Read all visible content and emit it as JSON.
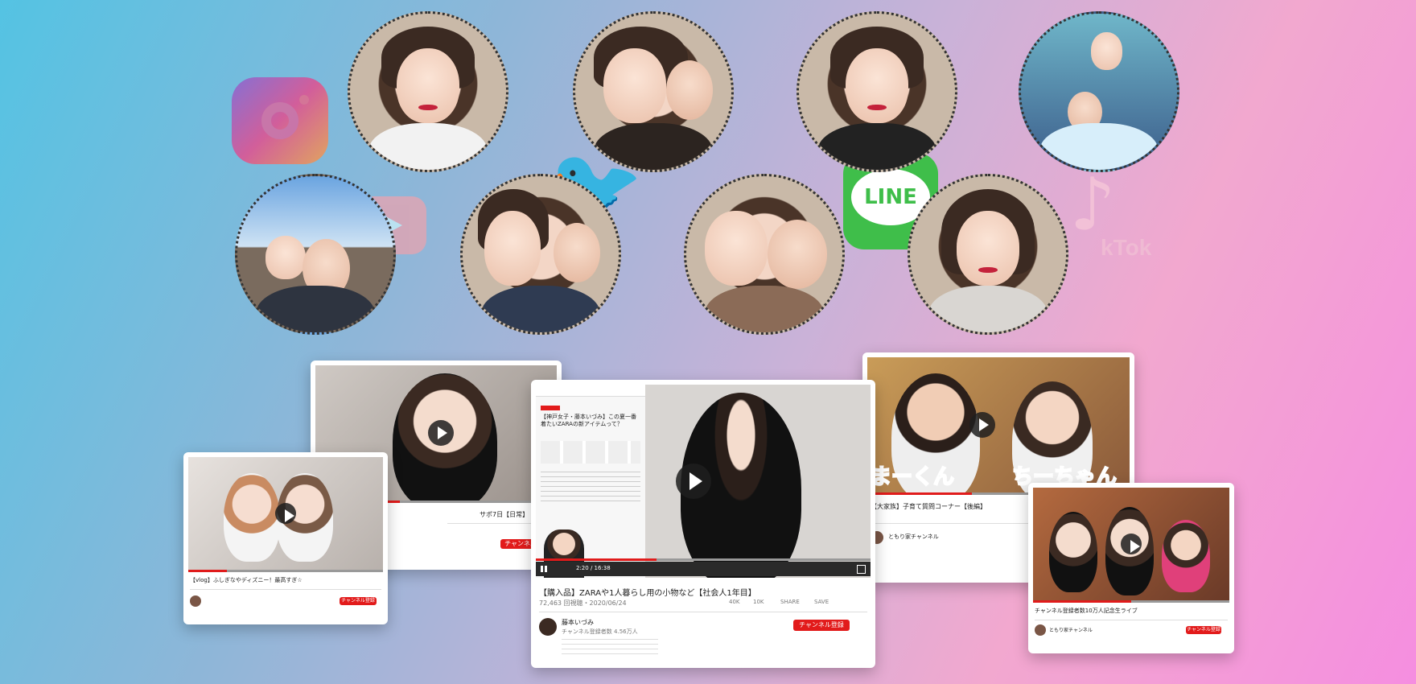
{
  "icons": {
    "instagram": "instagram-icon",
    "youtube": "youtube-icon",
    "twitter": "twitter-icon",
    "line": "line-icon",
    "line_label": "LINE",
    "tiktok": "tiktok-icon",
    "tiktok_label": "kTok"
  },
  "colors": {
    "accent_red": "#e21b1b",
    "line_green": "#3fbe4a",
    "twitter_blue": "#4aa3e8",
    "caption_green": "#2fb53a",
    "caption_pink": "#ef3f8a"
  },
  "main_card": {
    "title": "【購入品】ZARAや1人暮らし用の小物など【社会人1年目】",
    "meta": "72,463 回視聴・2020/06/24",
    "likes": "40K",
    "dislikes": "10K",
    "share": "SHARE",
    "save": "SAVE",
    "channel": "藤本いづみ",
    "subscribers": "チャンネル登録者数 4.56万人",
    "subscribe_label": "チャンネル登録",
    "time": "2:20 / 16:38",
    "article_heading": "【神戸女子・藤本いづみ】この夏一番着たいZARAの新アイテムって？"
  },
  "left_card": {
    "title": "【vlog】ふしぎなやディズニー！最高すぎ☆",
    "subscribe_label": "チャンネル登録"
  },
  "back_card": {
    "title": "サポ7日【日常】",
    "subscribe_label": "チャンネル登録"
  },
  "right_card": {
    "title": "【大家族】子育て質問コーナー【後編】",
    "caption_left": "まーくん",
    "caption_right": "ちーちゃん",
    "channel": "ともり家チャンネル"
  },
  "far_right_card": {
    "title": "チャンネル登録者数10万人記念生ライブ",
    "channel": "ともり家チャンネル",
    "subscribe_label": "チャンネル登録"
  }
}
